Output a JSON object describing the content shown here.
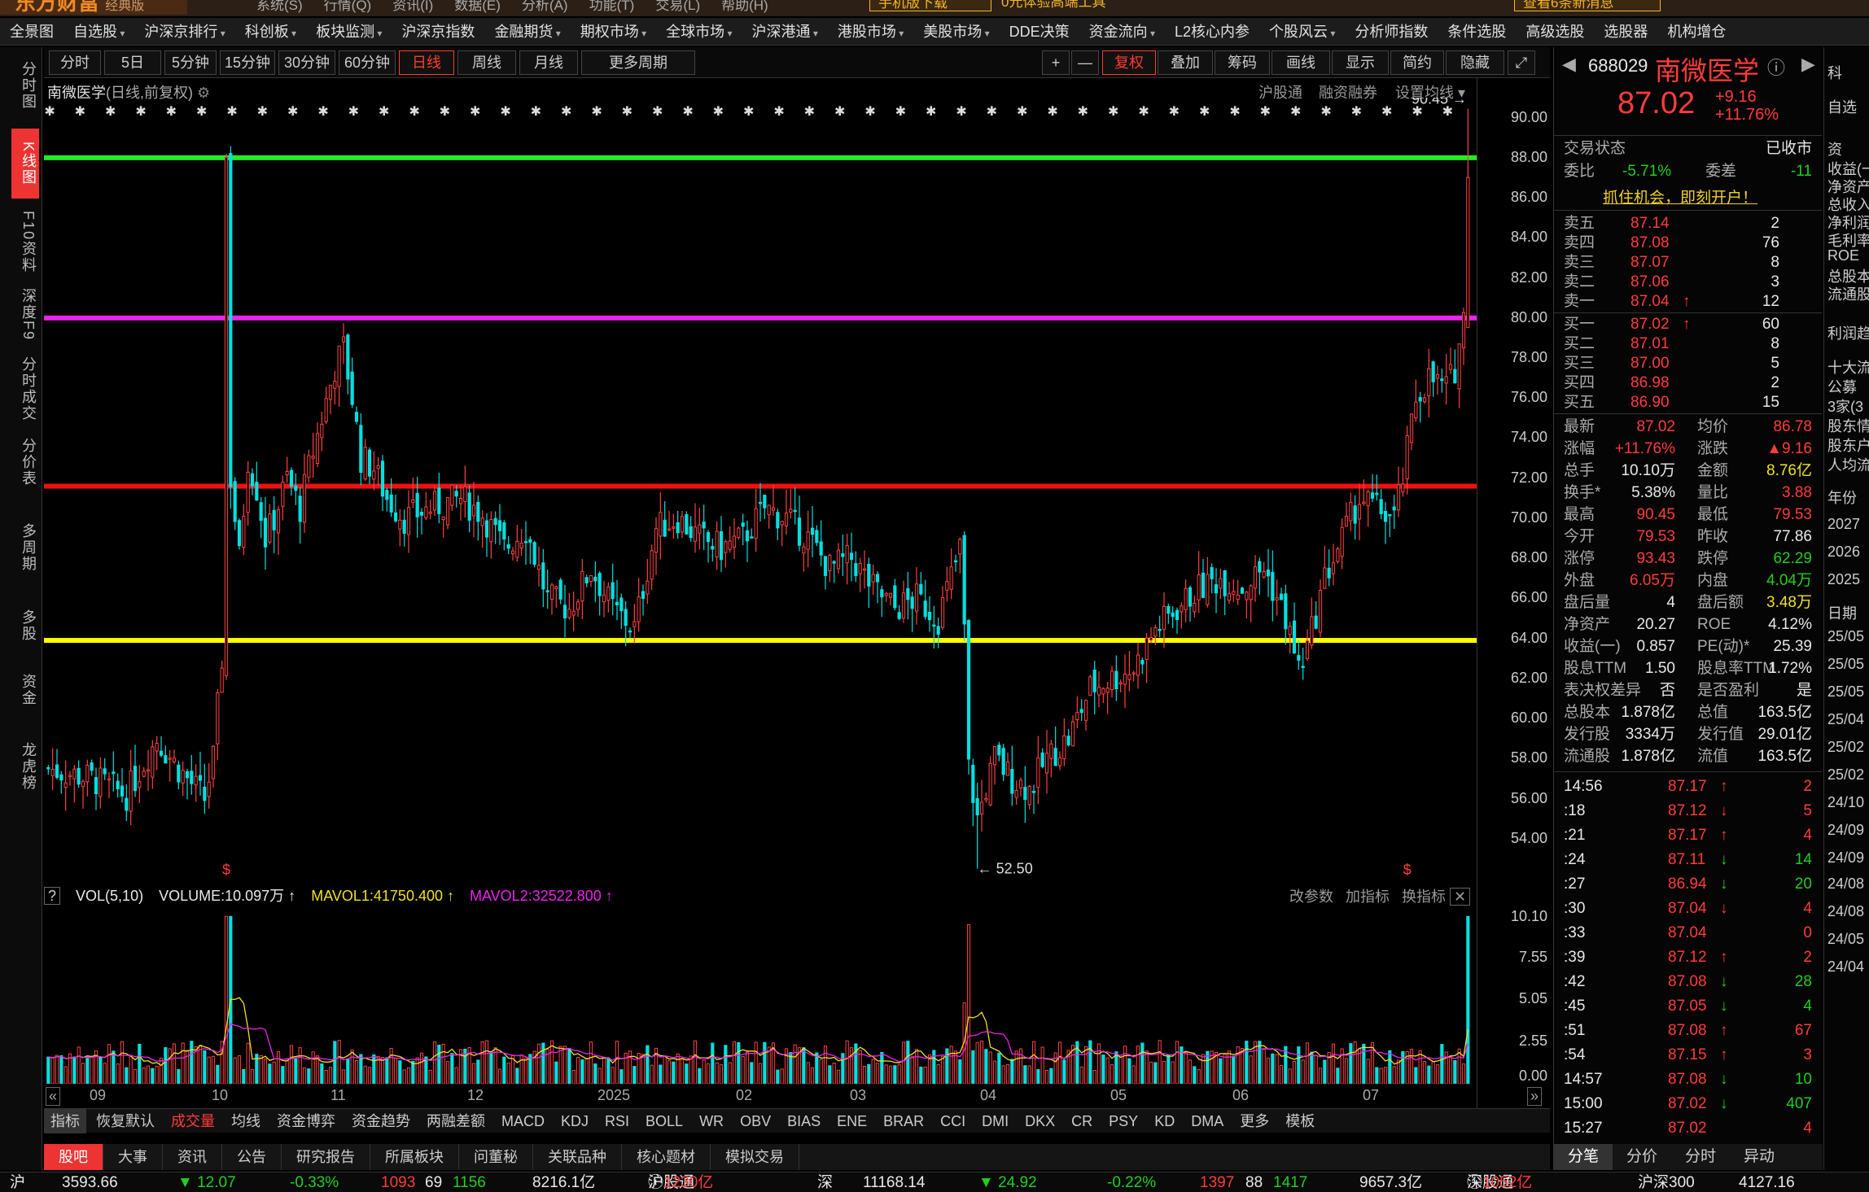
{
  "app": {
    "logo": "东方财富",
    "edition": "经典版",
    "menu": [
      "系统(S)",
      "行情(Q)",
      "资讯(I)",
      "数据(E)",
      "分析(A)",
      "功能(T)",
      "交易(L)",
      "帮助(H)"
    ],
    "promo1": "手机版下载",
    "promo2": "0元体验高端工具",
    "promo3": "查看6条新消息"
  },
  "nav": [
    {
      "t": "全景图",
      "dd": false
    },
    {
      "t": "自选股",
      "dd": true
    },
    {
      "t": "沪深京排行",
      "dd": true
    },
    {
      "t": "科创板",
      "dd": true
    },
    {
      "t": "板块监测",
      "dd": true
    },
    {
      "t": "沪深京指数",
      "dd": false
    },
    {
      "t": "金融期货",
      "dd": true
    },
    {
      "t": "期权市场",
      "dd": true
    },
    {
      "t": "全球市场",
      "dd": true
    },
    {
      "t": "沪深港通",
      "dd": true
    },
    {
      "t": "港股市场",
      "dd": true
    },
    {
      "t": "美股市场",
      "dd": true
    },
    {
      "t": "DDE决策",
      "dd": false
    },
    {
      "t": "资金流向",
      "dd": true
    },
    {
      "t": "L2核心内参",
      "dd": false
    },
    {
      "t": "个股风云",
      "dd": true
    },
    {
      "t": "分析师指数",
      "dd": false
    },
    {
      "t": "条件选股",
      "dd": false
    },
    {
      "t": "高级选股",
      "dd": false
    },
    {
      "t": "选股器",
      "dd": false
    },
    {
      "t": "机构增仓",
      "dd": false
    }
  ],
  "toolbar": {
    "periods": [
      "分时",
      "5日",
      "5分钟",
      "15分钟",
      "30分钟",
      "60分钟",
      "日线",
      "周线",
      "月线",
      "更多周期"
    ],
    "active": "日线",
    "right": [
      "复权",
      "叠加",
      "筹码",
      "画线",
      "显示",
      "简约",
      "隐藏"
    ],
    "plus": "+",
    "minus": "—"
  },
  "rail": [
    "分时图",
    "K线图",
    "F10资料",
    "深度F9",
    "分时成交",
    "分价表",
    "多周期",
    "多股",
    "资金",
    "龙虎榜"
  ],
  "chart": {
    "title": "南微医学",
    "mode": "(日线,前复权)",
    "links": [
      "沪股通",
      "融资融券",
      "设置均线"
    ],
    "high_label": "90.45",
    "low_label": "52.50",
    "yticks": [
      "90.00",
      "88.00",
      "86.00",
      "84.00",
      "82.00",
      "80.00",
      "78.00",
      "76.00",
      "74.00",
      "72.00",
      "70.00",
      "68.00",
      "66.00",
      "64.00",
      "62.00",
      "60.00",
      "58.00",
      "56.00",
      "54.00"
    ],
    "levels": [
      {
        "price": 88.0,
        "color": "#22ee22"
      },
      {
        "price": 80.0,
        "color": "#ee22ee"
      },
      {
        "price": 71.6,
        "color": "#ee1111"
      },
      {
        "price": 63.9,
        "color": "#ffff00"
      }
    ],
    "xticks": [
      "09",
      "10",
      "11",
      "12",
      "2025",
      "02",
      "03",
      "04",
      "05",
      "06",
      "07"
    ]
  },
  "chart_data": {
    "type": "candlestick",
    "title": "南微医学",
    "ylim": [
      52,
      91
    ],
    "volume_ylim": [
      0,
      10.5
    ],
    "xlabels": [
      "09",
      "10",
      "11",
      "12",
      "2025",
      "02",
      "03",
      "04",
      "05",
      "06",
      "07"
    ],
    "high": 90.45,
    "low": 52.5,
    "last": 87.02,
    "anchors": [
      [
        0,
        57.5
      ],
      [
        10,
        57.0
      ],
      [
        18,
        56.2
      ],
      [
        25,
        59.0
      ],
      [
        30,
        57.5
      ],
      [
        36,
        56.0
      ],
      [
        38,
        58.0
      ],
      [
        40,
        63.0
      ],
      [
        41,
        88.0
      ],
      [
        42,
        72.0
      ],
      [
        44,
        68.0
      ],
      [
        46,
        73.0
      ],
      [
        48,
        71.5
      ],
      [
        50,
        69.0
      ],
      [
        52,
        70.0
      ],
      [
        55,
        72.0
      ],
      [
        58,
        70.5
      ],
      [
        60,
        72.5
      ],
      [
        63,
        75.0
      ],
      [
        66,
        77.5
      ],
      [
        68,
        78.5
      ],
      [
        70,
        76.0
      ],
      [
        72,
        73.0
      ],
      [
        75,
        72.5
      ],
      [
        78,
        71.0
      ],
      [
        82,
        70.0
      ],
      [
        88,
        70.5
      ],
      [
        95,
        71.0
      ],
      [
        100,
        70.2
      ],
      [
        105,
        68.5
      ],
      [
        110,
        69.5
      ],
      [
        115,
        66.0
      ],
      [
        120,
        65.5
      ],
      [
        125,
        67.5
      ],
      [
        130,
        65.5
      ],
      [
        135,
        64.5
      ],
      [
        140,
        69.5
      ],
      [
        145,
        70.0
      ],
      [
        150,
        69.0
      ],
      [
        155,
        68.5
      ],
      [
        160,
        69.0
      ],
      [
        165,
        70.5
      ],
      [
        170,
        70.0
      ],
      [
        175,
        69.0
      ],
      [
        180,
        67.5
      ],
      [
        185,
        68.0
      ],
      [
        190,
        66.5
      ],
      [
        195,
        65.5
      ],
      [
        200,
        66.0
      ],
      [
        205,
        65.0
      ],
      [
        210,
        68.5
      ],
      [
        211,
        64.5
      ],
      [
        212,
        57.5
      ],
      [
        214,
        55.0
      ],
      [
        218,
        58.0
      ],
      [
        222,
        57.0
      ],
      [
        226,
        56.5
      ],
      [
        230,
        58.0
      ],
      [
        235,
        59.0
      ],
      [
        240,
        61.5
      ],
      [
        245,
        62.0
      ],
      [
        250,
        62.5
      ],
      [
        255,
        64.5
      ],
      [
        260,
        65.5
      ],
      [
        265,
        66.5
      ],
      [
        270,
        67.0
      ],
      [
        275,
        66.5
      ],
      [
        280,
        67.5
      ],
      [
        285,
        65.0
      ],
      [
        288,
        62.5
      ],
      [
        290,
        63.5
      ],
      [
        294,
        67.0
      ],
      [
        298,
        69.0
      ],
      [
        302,
        71.0
      ],
      [
        306,
        70.5
      ],
      [
        310,
        70.0
      ],
      [
        312,
        72.0
      ],
      [
        315,
        76.0
      ],
      [
        318,
        77.0
      ],
      [
        322,
        76.5
      ],
      [
        324,
        77.5
      ],
      [
        326,
        80.0
      ],
      [
        327,
        87.02
      ]
    ]
  },
  "vol": {
    "label": "VOL(5,10)",
    "volume": "VOLUME:10.097万",
    "m1": "MAVOL1:41750.400",
    "m2": "MAVOL2:32522.800",
    "links": [
      "改参数",
      "加指标",
      "换指标"
    ],
    "yticks": [
      "10.10",
      "7.55",
      "5.05",
      "2.55",
      "0.00"
    ]
  },
  "indicators": [
    "指标",
    "恢复默认",
    "成交量",
    "均线",
    "资金博弈",
    "资金趋势",
    "两融差额",
    "MACD",
    "KDJ",
    "RSI",
    "BOLL",
    "WR",
    "OBV",
    "BIAS",
    "ENE",
    "BRAR",
    "CCI",
    "DMI",
    "DKX",
    "CR",
    "PSY",
    "KD",
    "DMA",
    "更多",
    "模板"
  ],
  "bottomtabs": [
    "股吧",
    "大事",
    "资讯",
    "公告",
    "研究报告",
    "所属板块",
    "问董秘",
    "关联品种",
    "核心题材",
    "模拟交易"
  ],
  "quote": {
    "code": "688029",
    "name": "南微医学",
    "price": "87.02",
    "chg": "+9.16",
    "pct": "+11.76%",
    "status_l": "交易状态",
    "status_r": "已收市",
    "wb_l": "委比",
    "wb": "-5.71%",
    "wc_l": "委差",
    "wc": "-11",
    "promo": "抓住机会，即刻开户！",
    "sells": [
      {
        "n": "卖五",
        "p": "87.14",
        "v": "2",
        "arrow": ""
      },
      {
        "n": "卖四",
        "p": "87.08",
        "v": "76",
        "arrow": ""
      },
      {
        "n": "卖三",
        "p": "87.07",
        "v": "8",
        "arrow": ""
      },
      {
        "n": "卖二",
        "p": "87.06",
        "v": "3",
        "arrow": ""
      },
      {
        "n": "卖一",
        "p": "87.04",
        "v": "12",
        "arrow": "↑"
      }
    ],
    "buys": [
      {
        "n": "买一",
        "p": "87.02",
        "v": "60",
        "arrow": "↑"
      },
      {
        "n": "买二",
        "p": "87.01",
        "v": "8",
        "arrow": ""
      },
      {
        "n": "买三",
        "p": "87.00",
        "v": "5",
        "arrow": ""
      },
      {
        "n": "买四",
        "p": "86.98",
        "v": "2",
        "arrow": ""
      },
      {
        "n": "买五",
        "p": "86.90",
        "v": "15",
        "arrow": ""
      }
    ],
    "stats": [
      [
        "最新",
        "87.02",
        "red",
        "均价",
        "86.78",
        "red"
      ],
      [
        "涨幅",
        "+11.76%",
        "red",
        "涨跌",
        "▲9.16",
        "red"
      ],
      [
        "总手",
        "10.10万",
        "white",
        "金额",
        "8.76亿",
        "yellow"
      ],
      [
        "换手*",
        "5.38%",
        "white",
        "量比",
        "3.88",
        "red"
      ],
      [
        "最高",
        "90.45",
        "red",
        "最低",
        "79.53",
        "red"
      ],
      [
        "今开",
        "79.53",
        "red",
        "昨收",
        "77.86",
        "white"
      ],
      [
        "涨停",
        "93.43",
        "red",
        "跌停",
        "62.29",
        "green"
      ],
      [
        "外盘",
        "6.05万",
        "red",
        "内盘",
        "4.04万",
        "green"
      ],
      [
        "盘后量",
        "4",
        "white",
        "盘后额",
        "3.48万",
        "yellow"
      ],
      [
        "净资产",
        "20.27",
        "white",
        "ROE",
        "4.12%",
        "white"
      ],
      [
        "收益(一)",
        "0.857",
        "white",
        "PE(动)*",
        "25.39",
        "white"
      ],
      [
        "股息TTM",
        "1.50",
        "white",
        "股息率TTM",
        "1.72%",
        "white"
      ],
      [
        "表决权差异",
        "否",
        "white",
        "是否盈利",
        "是",
        "white"
      ],
      [
        "总股本",
        "1.878亿",
        "white",
        "总值",
        "163.5亿",
        "white"
      ],
      [
        "发行股",
        "3334万",
        "white",
        "发行值",
        "29.01亿",
        "white"
      ],
      [
        "流通股",
        "1.878亿",
        "white",
        "流值",
        "163.5亿",
        "white"
      ]
    ],
    "ticks": [
      [
        "14:56",
        "87.17",
        "↑",
        "2",
        "red"
      ],
      [
        ":18",
        "87.12",
        "↓",
        "5",
        "red"
      ],
      [
        ":21",
        "87.17",
        "↑",
        "4",
        "red"
      ],
      [
        ":24",
        "87.11",
        "↓",
        "14",
        "green"
      ],
      [
        ":27",
        "86.94",
        "↓",
        "20",
        "green"
      ],
      [
        ":30",
        "87.04",
        "↓",
        "4",
        "red"
      ],
      [
        ":33",
        "87.04",
        "",
        "0",
        "red"
      ],
      [
        ":39",
        "87.12",
        "↑",
        "2",
        "red"
      ],
      [
        ":42",
        "87.08",
        "↓",
        "28",
        "green"
      ],
      [
        ":45",
        "87.05",
        "↓",
        "4",
        "green"
      ],
      [
        ":51",
        "87.08",
        "↑",
        "67",
        "red"
      ],
      [
        ":54",
        "87.15",
        "↑",
        "3",
        "red"
      ],
      [
        "14:57",
        "87.08",
        "↓",
        "10",
        "green"
      ],
      [
        "15:00",
        "87.02",
        "↓",
        "407",
        "green"
      ],
      [
        "15:27",
        "87.02",
        "",
        "4",
        "red"
      ]
    ],
    "tabs": [
      "分笔",
      "分价",
      "分时",
      "异动"
    ]
  },
  "farright": {
    "items": [
      "科",
      "自选",
      "资",
      "收益(一",
      "净资产",
      "总收入",
      "净利润",
      "毛利率",
      "ROE",
      "总股本",
      "流通股",
      "利润趋",
      "十大流",
      "公募",
      "3家(3",
      "股东情",
      "股东户",
      "人均流",
      "年份",
      "2027",
      "2026",
      "2025",
      "日期",
      "25/05",
      "25/05",
      "25/05",
      "25/04",
      "25/02",
      "25/02",
      "24/10",
      "24/09",
      "24/09",
      "24/08",
      "24/08",
      "24/05",
      "24/04"
    ]
  },
  "statusbar": {
    "sh_label": "沪",
    "sh": "3593.66",
    "sh_chg": "▼ 12.07",
    "sh_pct": "-0.33%",
    "sh_up": "1093",
    "sh_flat": "69",
    "sh_down": "1156",
    "sh_amt": "8216.1亿",
    "hgt_label": "沪股通",
    "hgt": "1230亿",
    "sz_label": "深",
    "sz": "11168.14",
    "sz_chg": "▼ 24.92",
    "sz_pct": "-0.22%",
    "sz_up": "1397",
    "sz_flat": "88",
    "sz_down": "1417",
    "sz_amt": "9657.3亿",
    "sgt_label": "深股通",
    "sgt": "1052亿",
    "hs_label": "沪深300",
    "hs": "4127.16"
  }
}
